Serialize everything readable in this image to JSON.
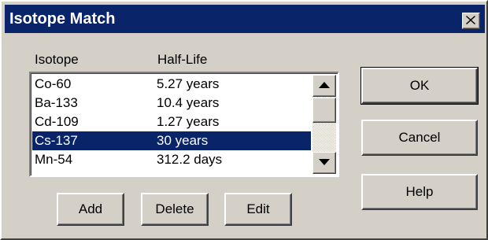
{
  "window": {
    "title": "Isotope Match",
    "close_icon": "close-icon"
  },
  "list": {
    "headers": {
      "isotope": "Isotope",
      "half_life": "Half-Life"
    },
    "rows": [
      {
        "isotope": "Co-60",
        "half_life": "5.27 years",
        "selected": false
      },
      {
        "isotope": "Ba-133",
        "half_life": "10.4 years",
        "selected": false
      },
      {
        "isotope": "Cd-109",
        "half_life": "1.27 years",
        "selected": false
      },
      {
        "isotope": "Cs-137",
        "half_life": "30 years",
        "selected": true
      },
      {
        "isotope": "Mn-54",
        "half_life": "312.2 days",
        "selected": false
      }
    ]
  },
  "buttons": {
    "ok": "OK",
    "cancel": "Cancel",
    "help": "Help",
    "add": "Add",
    "delete": "Delete",
    "edit": "Edit"
  },
  "colors": {
    "titlebar": "#0a246a",
    "selection": "#0a246a",
    "face": "#d4d0c8"
  }
}
